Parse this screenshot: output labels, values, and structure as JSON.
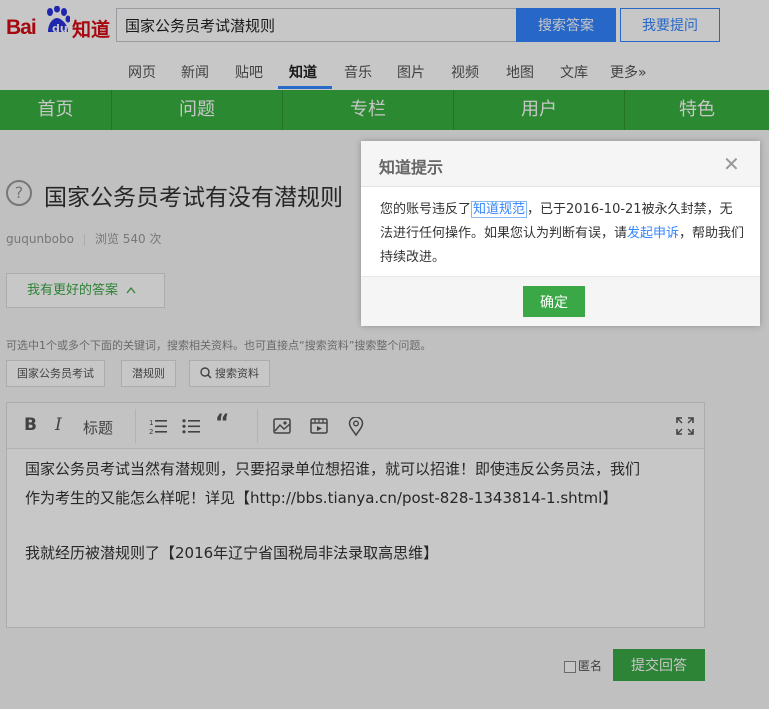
{
  "logo": {
    "bai": "Bai",
    "du": "du",
    "zhidao": "知道"
  },
  "search": {
    "query": "国家公务员考试潜规则",
    "search_button": "搜索答案",
    "ask_button": "我要提问"
  },
  "nav": {
    "items": [
      "网页",
      "新闻",
      "贴吧",
      "知道",
      "音乐",
      "图片",
      "视频",
      "地图",
      "文库",
      "更多»"
    ],
    "active": "知道"
  },
  "green_nav": {
    "items": [
      "首页",
      "问题",
      "专栏",
      "用户",
      "特色"
    ]
  },
  "question": {
    "title": "国家公务员考试有没有潜规则",
    "author": "guqunbobo",
    "views": "浏览 540 次"
  },
  "answer_area": {
    "better_answer_button": "我有更好的答案",
    "hint": "可选中1个或多个下面的关键词，搜索相关资料。也可直接点“搜索资料”搜索整个问题。",
    "keywords": [
      "国家公务员考试",
      "潜规则"
    ],
    "search_material": "搜索资料",
    "toolbar": {
      "bold": "B",
      "italic": "I",
      "heading": "标题"
    },
    "content_line1": "国家公务员考试当然有潜规则，只要招录单位想招谁，就可以招谁！即使违反公务员法，我们",
    "content_line2": "作为考生的又能怎么样呢！详见【http://bbs.tianya.cn/post-828-1343814-1.shtml】",
    "content_line3": "我就经历被潜规则了【2016年辽宁省国税局非法录取高思维】",
    "anonymous_label": "匿名",
    "submit_button": "提交回答"
  },
  "dialog": {
    "title": "知道提示",
    "close": "✕",
    "text_1": "您的账号违反了",
    "link_rules": "知道规范",
    "text_2": "，已于2016-10-21被永久封禁，无法进行任何操作。如果您认为判断有误，请",
    "link_appeal": "发起申诉",
    "text_3": "，帮助我们持续改进。",
    "ok_button": "确定"
  },
  "colors": {
    "brand_red": "#d50b14",
    "link_blue": "#3385ff",
    "green": "#38b03f"
  }
}
